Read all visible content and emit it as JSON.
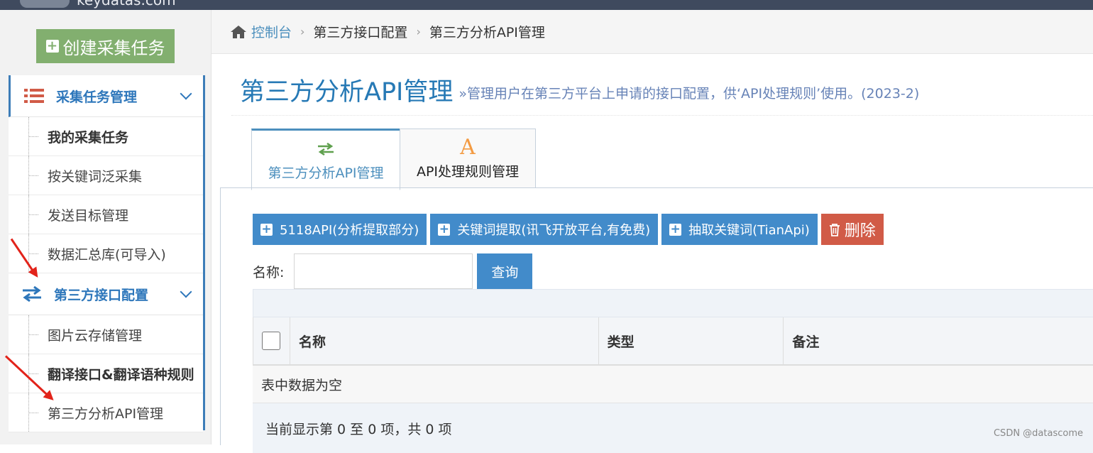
{
  "colors": {
    "accent": "#428bca",
    "danger": "#d15b47",
    "success": "#82af6f",
    "topbar": "#3f4a5e",
    "arrow": "#e2231a"
  },
  "topbar": {
    "brand": "keydatas.com"
  },
  "sidebar": {
    "create_button": "创建采集任务",
    "groups": [
      {
        "label": "采集任务管理",
        "icon": "list-icon",
        "items": [
          {
            "label": "我的采集任务"
          },
          {
            "label": "按关键词泛采集"
          },
          {
            "label": "发送目标管理"
          },
          {
            "label": "数据汇总库(可导入)"
          }
        ]
      },
      {
        "label": "第三方接口配置",
        "icon": "exchange-icon",
        "items": [
          {
            "label": "图片云存储管理"
          },
          {
            "label": "翻译接口&翻译语种规则"
          },
          {
            "label": "第三方分析API管理"
          }
        ]
      }
    ]
  },
  "breadcrumb": {
    "home": "控制台",
    "level2": "第三方接口配置",
    "level3": "第三方分析API管理"
  },
  "page": {
    "title": "第三方分析API管理",
    "subtitle": "»管理用户在第三方平台上申请的接口配置，供‘API处理规则’使用。(2023-2)"
  },
  "tabs": [
    {
      "label": "第三方分析API管理",
      "icon": "exchange-icon",
      "active": true
    },
    {
      "label": "API处理规则管理",
      "icon": "font-a-icon",
      "active": false
    }
  ],
  "toolbar": {
    "buttons": [
      {
        "label": "5118API(分析提取部分)"
      },
      {
        "label": "关键词提取(讯飞开放平台,有免费)"
      },
      {
        "label": "抽取关键词(TianApi)"
      }
    ],
    "delete_label": "删除"
  },
  "search": {
    "label": "名称:",
    "value": "",
    "button": "查询"
  },
  "table": {
    "columns": [
      "名称",
      "类型",
      "备注"
    ],
    "empty_text": "表中数据为空",
    "footer": "当前显示第 0 至 0 项，共 0 项"
  },
  "watermark": "CSDN @datascome"
}
